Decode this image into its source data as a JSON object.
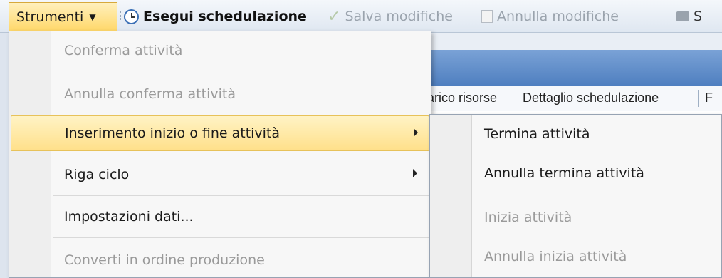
{
  "toolbar": {
    "strumenti_label": "Strumenti",
    "esegui_label": "Esegui schedulazione",
    "salva_label": "Salva modifiche",
    "annulla_label": "Annulla modifiche",
    "stampa_label": "S"
  },
  "background": {
    "tabs": [
      "arico risorse",
      "Dettaglio schedulazione",
      "F"
    ]
  },
  "menu": {
    "items": [
      {
        "label": "Conferma attività",
        "enabled": false
      },
      {
        "label": "Annulla conferma attività",
        "enabled": false
      },
      {
        "label": "Inserimento inizio o fine attività",
        "enabled": true,
        "submenu": true,
        "highlighted": true
      },
      {
        "label": "Riga ciclo",
        "enabled": true,
        "submenu": true
      },
      {
        "label": "Impostazioni dati...",
        "enabled": true
      },
      {
        "label": "Converti in ordine produzione",
        "enabled": false
      }
    ]
  },
  "submenu": {
    "items": [
      {
        "label": "Termina attività",
        "enabled": true
      },
      {
        "label": "Annulla termina attività",
        "enabled": true
      },
      {
        "label": "Inizia attività",
        "enabled": false
      },
      {
        "label": "Annulla inizia attività",
        "enabled": false
      }
    ]
  },
  "colors": {
    "highlight": "#ffe08a",
    "disabled_text": "#9a9a9a",
    "header_blue": "#4f7fc0"
  }
}
